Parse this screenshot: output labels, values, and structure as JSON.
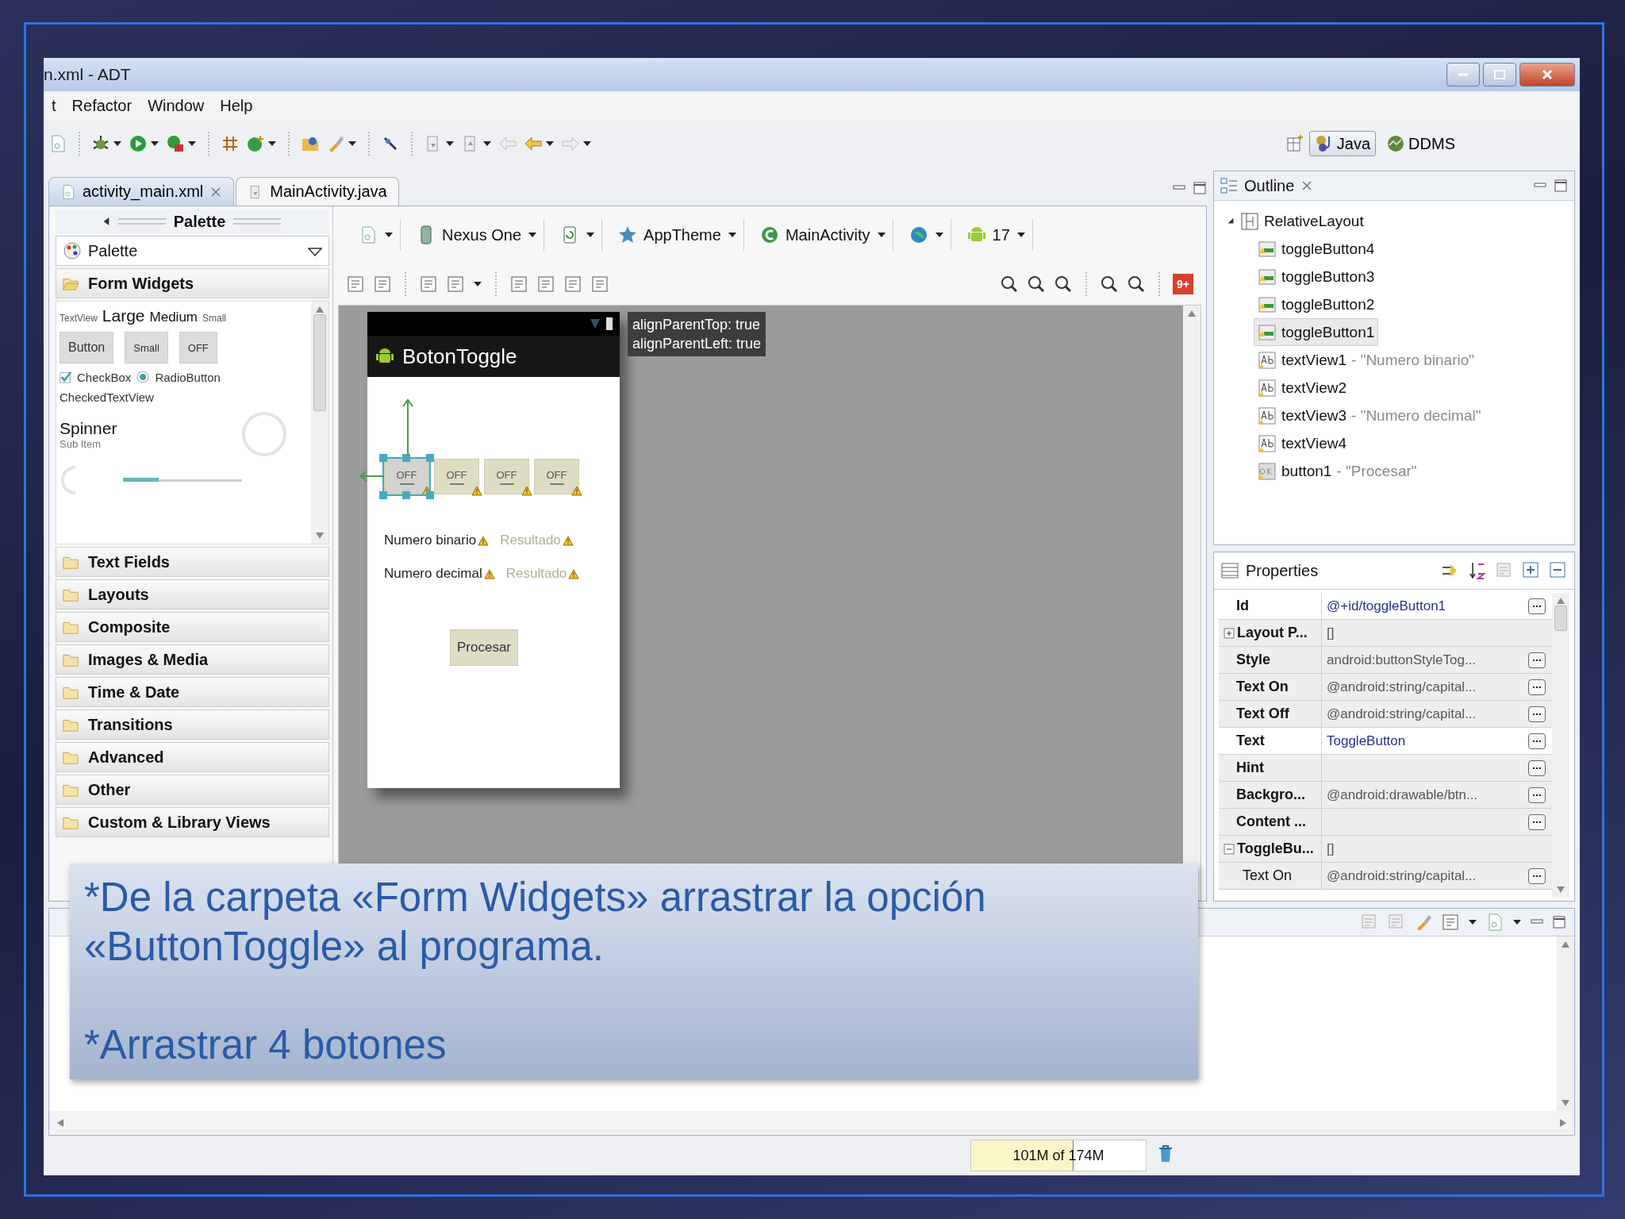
{
  "window": {
    "title": "n.xml - ADT"
  },
  "menu": [
    {
      "label": "t"
    },
    {
      "label": "Refactor"
    },
    {
      "label": "Window"
    },
    {
      "label": "Help"
    }
  ],
  "perspectives": [
    {
      "label": "Java",
      "selected": true
    },
    {
      "label": "DDMS",
      "selected": false
    }
  ],
  "editor_tabs": [
    {
      "label": "activity_main.xml",
      "selected": true
    },
    {
      "label": "MainActivity.java",
      "selected": false
    }
  ],
  "palette": {
    "title": "Palette",
    "filter": "Palette",
    "open_section": {
      "label": "Form Widgets",
      "expanded": true
    },
    "preview": {
      "textviews": [
        "TextView",
        "Large",
        "Medium",
        "Small"
      ],
      "buttons": [
        "Button",
        "Small",
        "OFF"
      ],
      "checkbox": {
        "label": "CheckBox",
        "checked": true
      },
      "radio": {
        "label": "RadioButton",
        "selected": true
      },
      "checked_text": "CheckedTextView",
      "spinner": {
        "label": "Spinner",
        "sub": "Sub Item"
      }
    },
    "sections": [
      {
        "label": "Text Fields",
        "expanded": false
      },
      {
        "label": "Layouts",
        "expanded": false
      },
      {
        "label": "Composite",
        "expanded": false
      },
      {
        "label": "Images & Media",
        "expanded": false
      },
      {
        "label": "Time & Date",
        "expanded": false
      },
      {
        "label": "Transitions",
        "expanded": false
      },
      {
        "label": "Advanced",
        "expanded": false
      },
      {
        "label": "Other",
        "expanded": false
      },
      {
        "label": "Custom & Library Views",
        "expanded": false
      }
    ]
  },
  "layout_toolbar": {
    "device": "Nexus One",
    "theme": "AppTheme",
    "activity": "MainActivity",
    "api": "17",
    "badge": "9+"
  },
  "canvas": {
    "app_title": "BotonToggle",
    "toggles": [
      {
        "label": "OFF",
        "selected": true
      },
      {
        "label": "OFF",
        "selected": false
      },
      {
        "label": "OFF",
        "selected": false
      },
      {
        "label": "OFF",
        "selected": false
      }
    ],
    "text_rows": [
      [
        {
          "text": "Numero binario",
          "kind": "text"
        },
        {
          "text": "Resultado",
          "kind": "hint"
        }
      ],
      [
        {
          "text": "Numero decimal",
          "kind": "text"
        },
        {
          "text": "Resultado",
          "kind": "hint"
        }
      ]
    ],
    "button": "Procesar",
    "tooltip": [
      "alignParentTop: true",
      "alignParentLeft: true"
    ]
  },
  "outline": {
    "title": "Outline",
    "tree": [
      {
        "name": "RelativeLayout",
        "kind": "layout",
        "expanded": true,
        "selected": false,
        "children": [
          {
            "name": "toggleButton4",
            "kind": "toggle",
            "selected": false
          },
          {
            "name": "toggleButton3",
            "kind": "toggle",
            "selected": false
          },
          {
            "name": "toggleButton2",
            "kind": "toggle",
            "selected": false
          },
          {
            "name": "toggleButton1",
            "kind": "toggle",
            "selected": true
          },
          {
            "name": "textView1",
            "detail": "- \"Numero binario\"",
            "kind": "text",
            "selected": false
          },
          {
            "name": "textView2",
            "kind": "text",
            "selected": false
          },
          {
            "name": "textView3",
            "detail": "- \"Numero decimal\"",
            "kind": "text",
            "selected": false
          },
          {
            "name": "textView4",
            "kind": "text",
            "selected": false
          },
          {
            "name": "button1",
            "detail": "- \"Procesar\"",
            "kind": "button",
            "selected": false
          }
        ]
      }
    ]
  },
  "properties": {
    "title": "Properties",
    "rows": [
      {
        "name": "Id",
        "value": "@+id/toggleButton1",
        "kind": "value",
        "set": true
      },
      {
        "name": "Layout P...",
        "value": "[]",
        "kind": "group",
        "expanded": false
      },
      {
        "name": "Style",
        "value": "android:buttonStyleTog...",
        "kind": "value",
        "set": false
      },
      {
        "name": "Text On",
        "value": "@android:string/capital...",
        "kind": "value",
        "set": false
      },
      {
        "name": "Text Off",
        "value": "@android:string/capital...",
        "kind": "value",
        "set": false
      },
      {
        "name": "Text",
        "value": "ToggleButton",
        "kind": "value",
        "set": true
      },
      {
        "name": "Hint",
        "kind": "value",
        "set": false
      },
      {
        "name": "Backgro...",
        "value": "@android:drawable/btn...",
        "kind": "value",
        "set": false
      },
      {
        "name": "Content ...",
        "kind": "value",
        "set": false
      },
      {
        "name": "ToggleBu...",
        "value": "[]",
        "kind": "group",
        "expanded": true,
        "children": [
          {
            "name": "Text On",
            "value": "@android:string/capital...",
            "kind": "value",
            "set": false
          }
        ]
      }
    ]
  },
  "note": {
    "paragraphs": [
      "*De la carpeta «Form Widgets» arrastrar la opción «ButtonToggle» al programa.",
      "*Arrastrar 4 botones"
    ]
  },
  "status_bar": {
    "heap": {
      "text": "101M of 174M",
      "level": 0.58
    }
  }
}
